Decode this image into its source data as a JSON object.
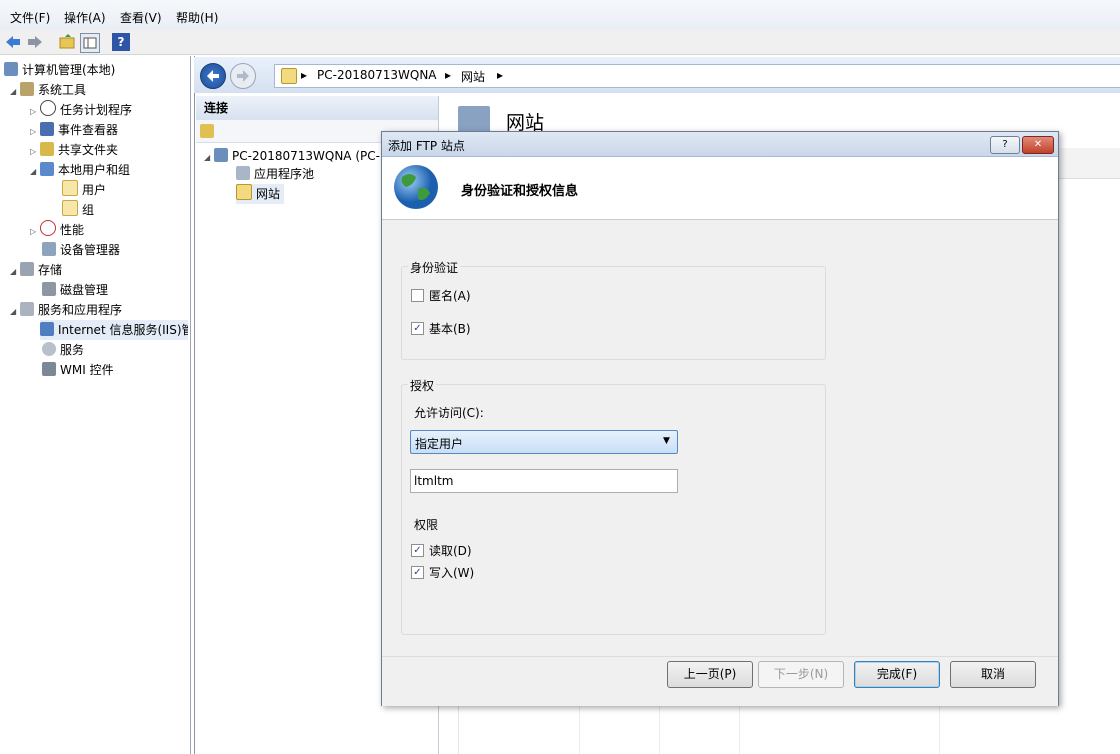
{
  "menu": [
    "文件(F)",
    "操作(A)",
    "查看(V)",
    "帮助(H)"
  ],
  "toolbar_icons": [
    "back-arrow-icon",
    "forward-arrow-icon",
    "folder-up-icon",
    "show-hide-tree-icon",
    "help-icon"
  ],
  "tree": {
    "root": "计算机管理(本地)",
    "items": [
      {
        "label": "系统工具",
        "icon": "tools-icon"
      },
      {
        "label": "任务计划程序",
        "icon": "clock-icon"
      },
      {
        "label": "事件查看器",
        "icon": "event-viewer-icon"
      },
      {
        "label": "共享文件夹",
        "icon": "shared-folder-icon"
      },
      {
        "label": "本地用户和组",
        "icon": "users-icon"
      },
      {
        "label": "用户",
        "icon": "folder-icon"
      },
      {
        "label": "组",
        "icon": "folder-icon"
      },
      {
        "label": "性能",
        "icon": "performance-icon"
      },
      {
        "label": "设备管理器",
        "icon": "device-manager-icon"
      },
      {
        "label": "存储",
        "icon": "storage-icon"
      },
      {
        "label": "磁盘管理",
        "icon": "disk-icon"
      },
      {
        "label": "服务和应用程序",
        "icon": "services-apps-icon"
      },
      {
        "label": "Internet 信息服务(IIS)管",
        "icon": "iis-icon"
      },
      {
        "label": "服务",
        "icon": "gear-icon"
      },
      {
        "label": "WMI 控件",
        "icon": "wmi-icon"
      }
    ]
  },
  "address": {
    "crumbs": [
      "PC-20180713WQNA",
      "网站"
    ]
  },
  "connections": {
    "header": "连接",
    "server": "PC-20180713WQNA (PC-",
    "app_pools": "应用程序池",
    "sites": "网站"
  },
  "main_title": "网站",
  "dialog": {
    "title": "添加 FTP 站点",
    "heading": "身份验证和授权信息",
    "help_btn": "?",
    "close_btn": "✕",
    "auth_group": "身份验证",
    "anonymous": "匿名(A)",
    "anonymous_checked": false,
    "basic": "基本(B)",
    "basic_checked": true,
    "authz_group": "授权",
    "allow_access_label": "允许访问(C):",
    "allow_access_value": "指定用户",
    "user_value": "ltmltm",
    "permissions_label": "权限",
    "read": "读取(D)",
    "read_checked": true,
    "write": "写入(W)",
    "write_checked": true,
    "buttons": {
      "prev": "上一页(P)",
      "next": "下一步(N)",
      "finish": "完成(F)",
      "cancel": "取消"
    }
  },
  "colors": {
    "accent": "#3a6fb0",
    "selection": "#e3ecf7"
  }
}
